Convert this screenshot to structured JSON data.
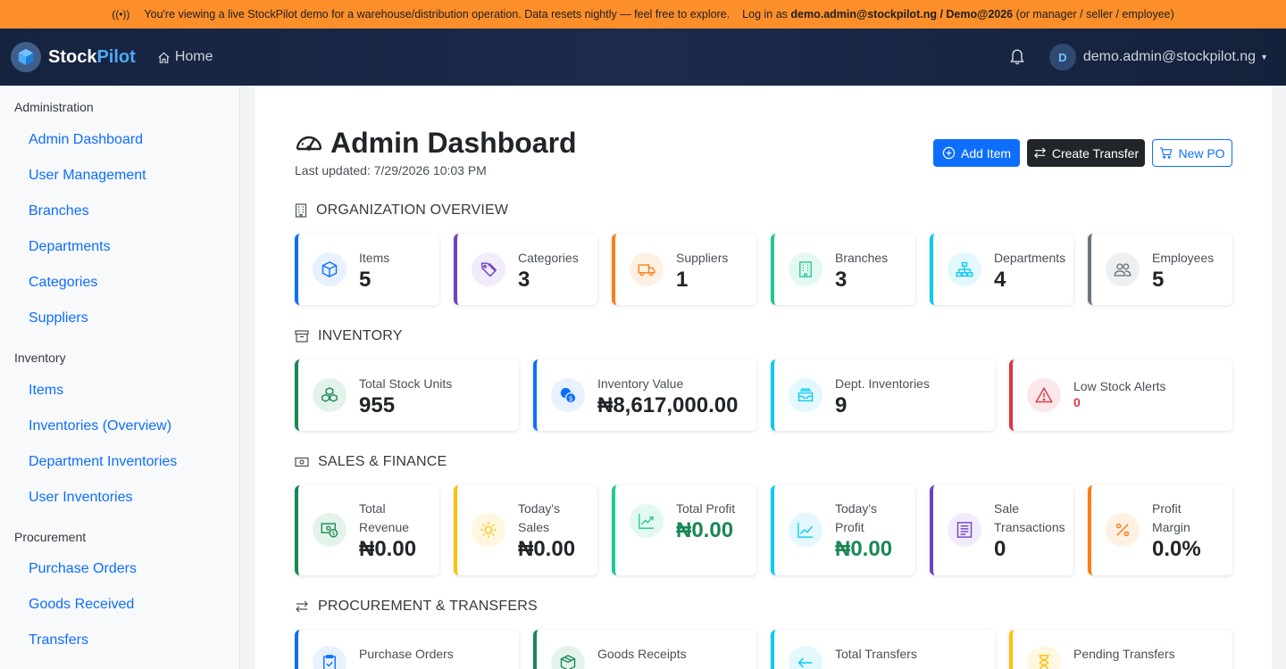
{
  "banner": {
    "text": "You're viewing a live StockPilot demo for a warehouse/distribution operation. Data resets nightly — feel free to explore.",
    "login_prefix": "Log in as",
    "login_credentials": "demo.admin@stockpilot.ng / Demo@2026",
    "login_suffix": "(or manager / seller / employee)"
  },
  "navbar": {
    "brand_stock": "Stock",
    "brand_pilot": "Pilot",
    "home": "Home",
    "user_initial": "D",
    "user_email": "demo.admin@stockpilot.ng"
  },
  "sidebar": {
    "groups": [
      {
        "title": "Administration",
        "items": [
          "Admin Dashboard",
          "User Management",
          "Branches",
          "Departments",
          "Categories",
          "Suppliers"
        ]
      },
      {
        "title": "Inventory",
        "items": [
          "Items",
          "Inventories (Overview)",
          "Department Inventories",
          "User Inventories"
        ]
      },
      {
        "title": "Procurement",
        "items": [
          "Purchase Orders",
          "Goods Received",
          "Transfers"
        ]
      }
    ]
  },
  "header": {
    "title": "Admin Dashboard",
    "last_updated": "Last updated: 7/29/2026 10:03 PM",
    "add_item": "Add Item",
    "create_transfer": "Create Transfer",
    "new_po": "New PO"
  },
  "sections": {
    "org": "ORGANIZATION OVERVIEW",
    "inventory": "INVENTORY",
    "sales": "SALES & FINANCE",
    "procurement": "PROCUREMENT & TRANSFERS"
  },
  "org_cards": [
    {
      "label": "Items",
      "value": "5",
      "icon": "box-icon",
      "color": "#0d6efd"
    },
    {
      "label": "Categories",
      "value": "3",
      "icon": "tags-icon",
      "color": "#6f42c1"
    },
    {
      "label": "Suppliers",
      "value": "1",
      "icon": "truck-icon",
      "color": "#fd7e14"
    },
    {
      "label": "Branches",
      "value": "3",
      "icon": "building-icon",
      "color": "#20c997"
    },
    {
      "label": "Departments",
      "value": "4",
      "icon": "diagram-icon",
      "color": "#0dcaf0"
    },
    {
      "label": "Employees",
      "value": "5",
      "icon": "people-icon",
      "color": "#6c757d"
    }
  ],
  "inventory_cards": [
    {
      "label": "Total Stock Units",
      "value": "955",
      "icon": "boxes-icon",
      "color": "#198754"
    },
    {
      "label": "Inventory Value",
      "value": "₦8,617,000.00",
      "icon": "coins-icon",
      "color": "#0d6efd"
    },
    {
      "label": "Dept. Inventories",
      "value": "9",
      "icon": "inboxes-icon",
      "color": "#0dcaf0"
    },
    {
      "label": "Low Stock Alerts",
      "value": "0",
      "icon": "warning-icon",
      "color": "#dc3545"
    }
  ],
  "sales_cards": [
    {
      "label1": "Total",
      "label2": "Revenue",
      "value": "₦0.00",
      "icon": "cash-icon",
      "color": "#198754"
    },
    {
      "label1": "Today's",
      "label2": "Sales",
      "value": "₦0.00",
      "icon": "sun-icon",
      "color": "#ffc107"
    },
    {
      "label1": "Total Profit",
      "label2": "",
      "value": "₦0.00",
      "icon": "graph-up-icon",
      "color": "#20c997"
    },
    {
      "label1": "Today's",
      "label2": "Profit",
      "value": "₦0.00",
      "icon": "graph-icon",
      "color": "#0dcaf0"
    },
    {
      "label1": "Sale",
      "label2": "Transactions",
      "value": "0",
      "icon": "receipt-icon",
      "color": "#6f42c1"
    },
    {
      "label1": "Profit",
      "label2": "Margin",
      "value": "0.0%",
      "icon": "percent-icon",
      "color": "#fd7e14"
    }
  ],
  "procurement_cards": [
    {
      "label": "Purchase Orders",
      "icon": "clipboard-icon",
      "color": "#0d6efd"
    },
    {
      "label": "Goods Receipts",
      "icon": "box-seam-icon",
      "color": "#198754"
    },
    {
      "label": "Total Transfers",
      "icon": "arrow-left-icon",
      "color": "#0dcaf0"
    },
    {
      "label": "Pending Transfers",
      "icon": "hourglass-icon",
      "color": "#ffc107"
    }
  ]
}
